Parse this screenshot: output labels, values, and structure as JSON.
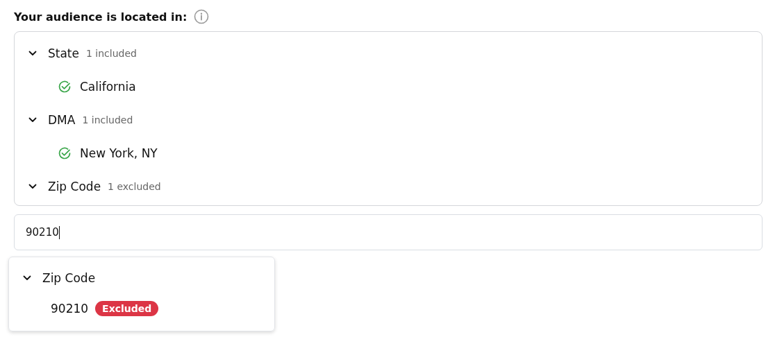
{
  "heading": {
    "title": "Your audience is located in:"
  },
  "groups": [
    {
      "label": "State",
      "summary": "1 included",
      "expanded": true,
      "items": [
        {
          "label": "California",
          "included": true
        }
      ]
    },
    {
      "label": "DMA",
      "summary": "1 included",
      "expanded": true,
      "items": [
        {
          "label": "New York, NY",
          "included": true
        }
      ]
    },
    {
      "label": "Zip Code",
      "summary": "1 excluded",
      "expanded": true
    }
  ],
  "search": {
    "value": "90210"
  },
  "results": [
    {
      "label": "Zip Code",
      "expanded": true,
      "items": [
        {
          "label": "90210",
          "badge": "Excluded",
          "excluded": true
        }
      ]
    }
  ]
}
